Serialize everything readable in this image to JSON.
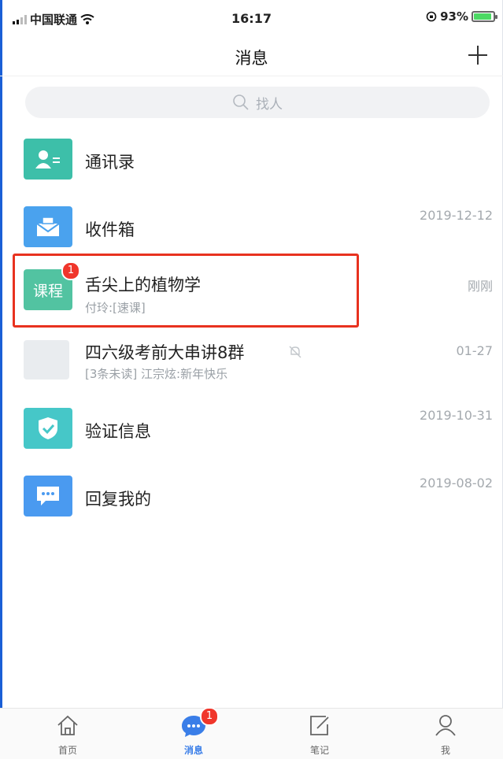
{
  "status_bar": {
    "carrier": "中国联通",
    "time": "16:17",
    "battery": "93%"
  },
  "nav": {
    "title": "消息",
    "add_label": "+"
  },
  "search": {
    "placeholder": "找人"
  },
  "rows": [
    {
      "title": "通讯录",
      "subtitle": "",
      "time": "",
      "icon": "contacts-icon",
      "color": "#3dbfa9"
    },
    {
      "title": "收件箱",
      "subtitle": "",
      "time": "2019-12-12",
      "icon": "inbox-icon",
      "color": "#4aa2ee"
    },
    {
      "title": "舌尖上的植物学",
      "subtitle": "付玲:[速课]",
      "time": "刚刚",
      "icon_text": "课程",
      "badge": "1",
      "color": "#52c3a1"
    },
    {
      "title": "四六级考前大串讲8群",
      "subtitle": "[3条未读] 江宗炫:新年快乐",
      "time": "01-27",
      "icon": "group-avatar"
    },
    {
      "title": "验证信息",
      "subtitle": "",
      "time": "2019-10-31",
      "icon": "shield-check-icon",
      "color": "#46c7c8"
    },
    {
      "title": "回复我的",
      "subtitle": "",
      "time": "2019-08-02",
      "icon": "chat-bubble-icon",
      "color": "#4a9af0"
    }
  ],
  "tabs": [
    {
      "label": "首页",
      "icon": "home-icon"
    },
    {
      "label": "消息",
      "icon": "message-icon",
      "badge": "1"
    },
    {
      "label": "笔记",
      "icon": "note-icon"
    },
    {
      "label": "我",
      "icon": "profile-icon"
    }
  ]
}
